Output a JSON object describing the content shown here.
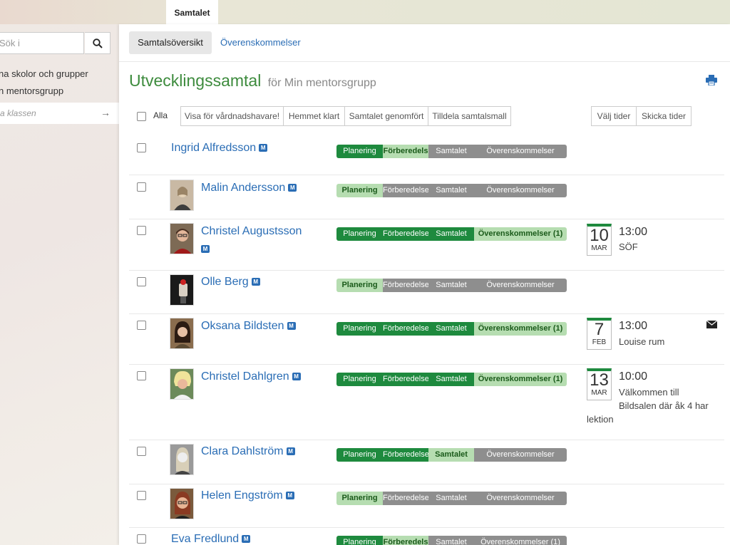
{
  "top_tab": "Samtalet",
  "sidebar": {
    "search_placeholder": "Sök i",
    "items": [
      {
        "label": "na skolor och grupper"
      },
      {
        "label": "n mentorsgrupp"
      }
    ],
    "current": "a klassen",
    "current_arrow": "→"
  },
  "subnav": {
    "tabs": [
      "Samtalsöversikt",
      "Överenskommelser"
    ]
  },
  "header": {
    "title": "Utvecklingssamtal",
    "subtitle": "för Min mentorsgrupp"
  },
  "toolbar": {
    "all_label": "Alla",
    "buttons": [
      "Visa för vårdnadshavare!",
      "Hemmet klart",
      "Samtalet genomfört",
      "Tilldela samtalsmall"
    ],
    "right_buttons": [
      "Välj tider",
      "Skicka tider"
    ]
  },
  "badge_label": "M",
  "stage_labels_full": [
    "Planering",
    "Förberedelse",
    "Samtalet",
    "Överenskommelser"
  ],
  "stage_labels_alt": [
    "Planering",
    "Förberedels",
    "Samtalet",
    "Överenskommelser"
  ],
  "students": [
    {
      "name": "Ingrid Alfredsson",
      "stages": [
        "dark",
        "light",
        "gray",
        "gray"
      ],
      "stage_labels": [
        "Planering",
        "Förberedels",
        "Samtalet",
        "Överenskommelser"
      ]
    },
    {
      "name": "Malin Andersson",
      "stages": [
        "light",
        "gray",
        "gray",
        "gray"
      ],
      "stage_labels": [
        "Planering",
        "Förberedelse",
        "Samtalet",
        "Överenskommelser"
      ]
    },
    {
      "name": "Christel Augustsson",
      "stages": [
        "dark",
        "dark",
        "dark",
        "light"
      ],
      "stage_labels": [
        "Planering",
        "Förberedelse",
        "Samtalet",
        "Överenskommelser (1)"
      ],
      "meeting": {
        "day": "10",
        "month": "MAR",
        "time": "13:00",
        "note": "SÖF"
      }
    },
    {
      "name": "Olle Berg",
      "stages": [
        "light",
        "gray",
        "gray",
        "gray"
      ],
      "stage_labels": [
        "Planering",
        "Förberedelse",
        "Samtalet",
        "Överenskommelser"
      ]
    },
    {
      "name": "Oksana Bildsten",
      "stages": [
        "dark",
        "dark",
        "dark",
        "light"
      ],
      "stage_labels": [
        "Planering",
        "Förberedelse",
        "Samtalet",
        "Överenskommelser (1)"
      ],
      "meeting": {
        "day": "7",
        "month": "FEB",
        "time": "13:00",
        "note": "Louise rum"
      }
    },
    {
      "name": "Christel Dahlgren",
      "stages": [
        "dark",
        "dark",
        "dark",
        "light"
      ],
      "stage_labels": [
        "Planering",
        "Förberedelse",
        "Samtalet",
        "Överenskommelser (1)"
      ],
      "meeting": {
        "day": "13",
        "month": "MAR",
        "time": "10:00",
        "note_lines": [
          "Välkommen till",
          "Bildsalen där åk 4 har",
          "lektion"
        ]
      }
    },
    {
      "name": "Clara Dahlström",
      "stages": [
        "dark",
        "dark",
        "light",
        "gray"
      ],
      "stage_labels": [
        "Planering",
        "Förberedelse",
        "Samtalet",
        "Överenskommelser"
      ]
    },
    {
      "name": "Helen Engström",
      "stages": [
        "light",
        "gray",
        "gray",
        "gray"
      ],
      "stage_labels": [
        "Planering",
        "Förberedelse",
        "Samtalet",
        "Överenskommelser"
      ]
    },
    {
      "name": "Eva Fredlund",
      "stages": [
        "dark",
        "light",
        "gray",
        "gray"
      ],
      "stage_labels": [
        "Planering",
        "Förberedels",
        "Samtalet",
        "Överenskommelser (1)"
      ]
    }
  ],
  "colors": {
    "dark_green": "#1e8a3e",
    "light_green": "#b6ddb1",
    "gray": "#8e8e8e",
    "link_blue": "#2a6db5",
    "title_green": "#3d8b3d"
  }
}
